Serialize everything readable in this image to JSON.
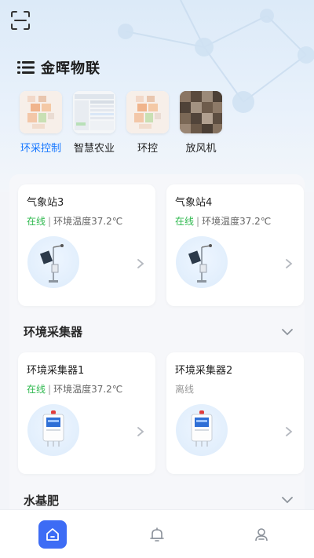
{
  "app": {
    "title": "金晖物联"
  },
  "icons": {
    "scan": "scan-icon",
    "menu": "menu-list-icon",
    "home": "home-icon",
    "bell": "bell-icon",
    "user": "user-icon"
  },
  "colors": {
    "accent": "#1677ff",
    "online": "#2db84d",
    "offline": "#999999",
    "tab_active": "#3d6cf5"
  },
  "apps": [
    {
      "label": "环采控制",
      "active": true
    },
    {
      "label": "智慧农业",
      "active": false
    },
    {
      "label": "环控",
      "active": false
    },
    {
      "label": "放风机",
      "active": false
    }
  ],
  "weather_stations": [
    {
      "name": "气象站3",
      "status": "在线",
      "separator": "|",
      "metric": "环境温度37.2℃"
    },
    {
      "name": "气象站4",
      "status": "在线",
      "separator": "|",
      "metric": "环境温度37.2℃"
    }
  ],
  "sections": {
    "collectors": {
      "title": "环境采集器"
    },
    "fertilizer": {
      "title": "水基肥"
    }
  },
  "collectors": [
    {
      "name": "环境采集器1",
      "status": "在线",
      "separator": "|",
      "metric": "环境温度37.2℃"
    },
    {
      "name": "环境采集器2",
      "status": "离线"
    }
  ],
  "tabbar": {
    "active": "home"
  }
}
